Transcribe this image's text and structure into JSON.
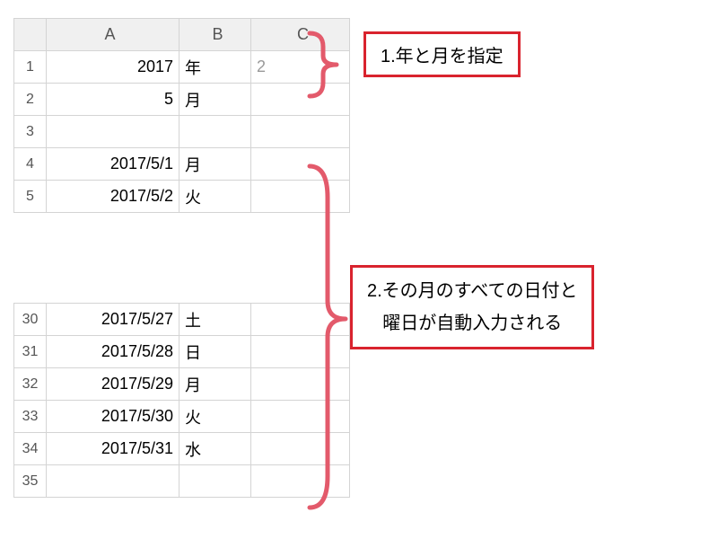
{
  "columns": [
    "A",
    "B",
    "C"
  ],
  "rows": [
    {
      "num": "1",
      "A": "2017",
      "B": "年",
      "C_partial": "2"
    },
    {
      "num": "2",
      "A": "5",
      "B": "月",
      "C": ""
    },
    {
      "num": "3",
      "A": "",
      "B": "",
      "C": ""
    },
    {
      "num": "4",
      "A": "2017/5/1",
      "B": "月",
      "C": ""
    },
    {
      "num": "5",
      "A": "2017/5/2",
      "B": "火",
      "C": ""
    }
  ],
  "rows2": [
    {
      "num": "30",
      "A": "2017/5/27",
      "B": "土",
      "C": ""
    },
    {
      "num": "31",
      "A": "2017/5/28",
      "B": "日",
      "C": ""
    },
    {
      "num": "32",
      "A": "2017/5/29",
      "B": "月",
      "C": ""
    },
    {
      "num": "33",
      "A": "2017/5/30",
      "B": "火",
      "C": ""
    },
    {
      "num": "34",
      "A": "2017/5/31",
      "B": "水",
      "C": ""
    },
    {
      "num": "35",
      "A": "",
      "B": "",
      "C": ""
    }
  ],
  "annotations": {
    "label1": "1.年と月を指定",
    "label2_line1": "2.その月のすべての日付と",
    "label2_line2": "曜日が自動入力される"
  }
}
